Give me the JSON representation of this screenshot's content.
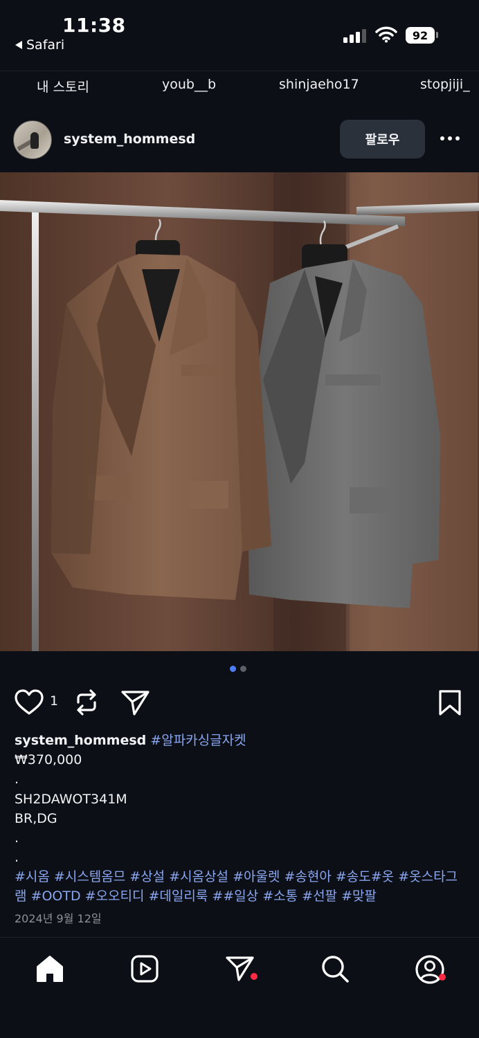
{
  "status_bar": {
    "time": "11:38",
    "back_app": "Safari",
    "battery": "92"
  },
  "stories": {
    "items": [
      "내 스토리",
      "youb__b",
      "shinjaeho17",
      "stopjiji_"
    ]
  },
  "post": {
    "username": "system_hommesd",
    "follow_label": "팔로우",
    "like_count": "1",
    "carousel_total": 2,
    "carousel_active": 1,
    "colors": {
      "accent_dot": "#4f7df7",
      "tag": "#8aa6f0",
      "notification": "#ff2a43"
    }
  },
  "caption": {
    "username": "system_hommesd",
    "first_tag": "#알파카싱글자켓",
    "price": "₩370,000",
    "dot1": ".",
    "code": "SH2DAWOT341M",
    "colors": "BR,DG",
    "dot2": ".",
    "dot3": ".",
    "tags_line1": "#시옴 #시스템옴므 #상설 #시옴상설 #아울렛 #송현아 #송도#옷 #옷스타그",
    "tags_line2": "램 #OOTD #오오티디 #데일리룩 ##일상 #소통 #선팔 #맞팔",
    "date": "2024년 9월 12일"
  },
  "icons": {
    "like": "heart-icon",
    "repost": "repost-icon",
    "share": "send-icon",
    "save": "bookmark-icon",
    "nav": [
      "home-icon",
      "reels-icon",
      "send-icon",
      "search-icon",
      "profile-icon"
    ]
  }
}
